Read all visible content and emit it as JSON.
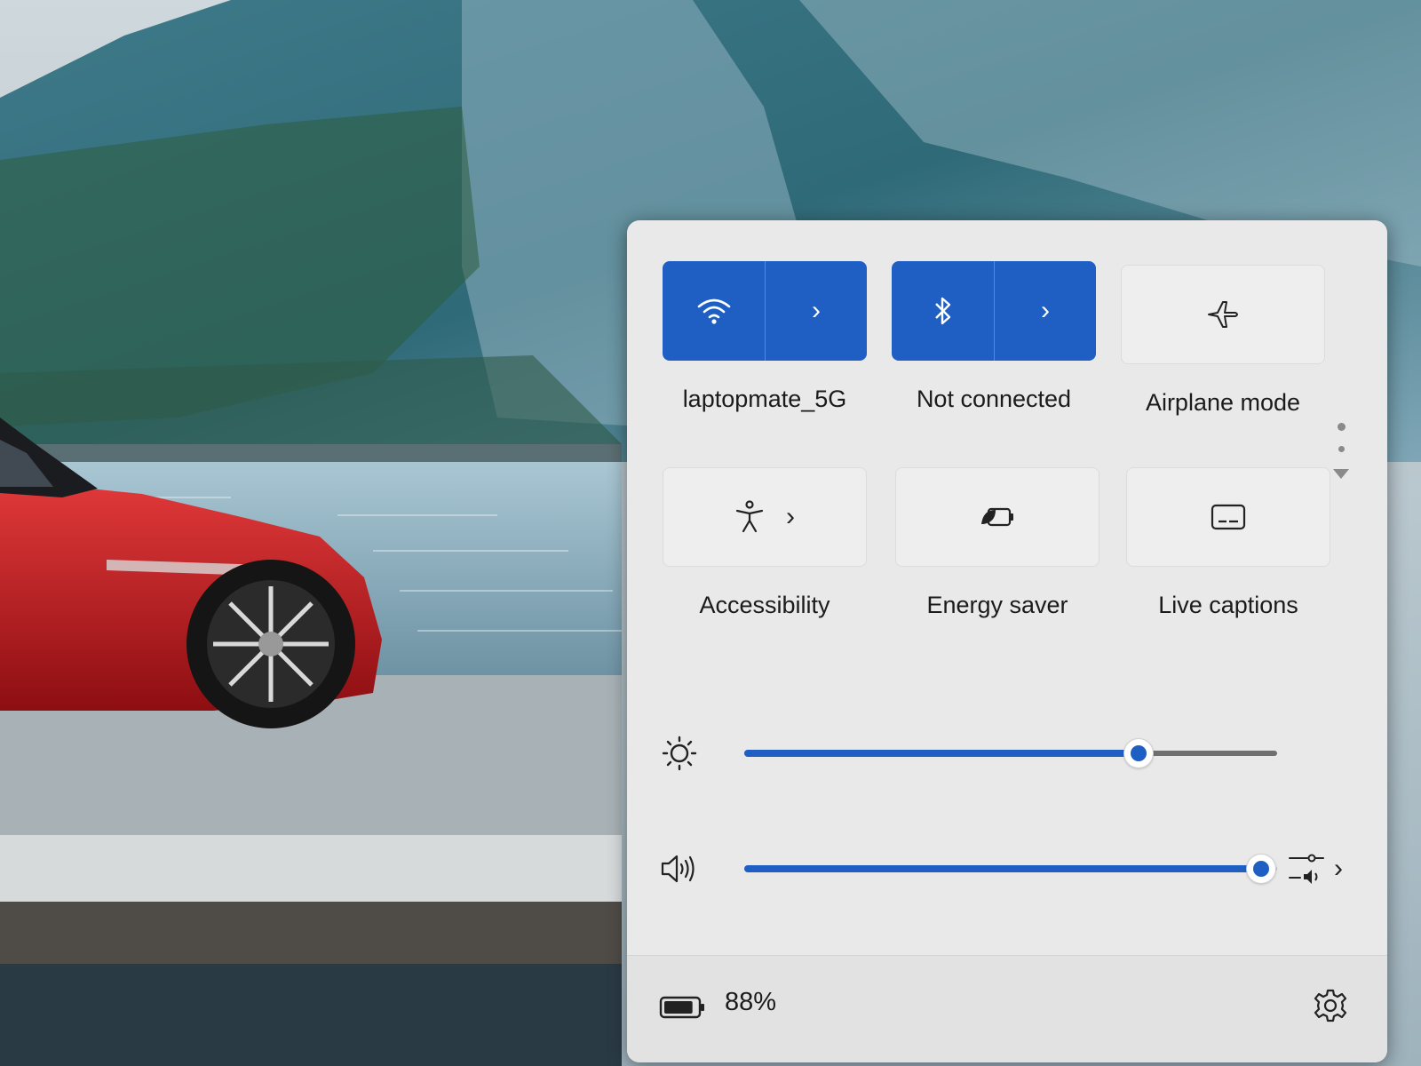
{
  "quick_settings": {
    "tiles": [
      {
        "label": "laptopmate_5G",
        "icon": "wifi-icon",
        "state": "on",
        "has_arrow": true
      },
      {
        "label": "Not connected",
        "icon": "bluetooth-icon",
        "state": "on",
        "has_arrow": true
      },
      {
        "label": "Airplane mode",
        "icon": "airplane-icon",
        "state": "off",
        "has_arrow": false
      },
      {
        "label": "Accessibility",
        "icon": "accessibility-icon",
        "state": "off",
        "has_arrow": true
      },
      {
        "label": "Energy saver",
        "icon": "energy-saver-icon",
        "state": "off",
        "has_arrow": false
      },
      {
        "label": "Live captions",
        "icon": "live-captions-icon",
        "state": "off",
        "has_arrow": false
      }
    ],
    "arrow_glyph": "›",
    "brightness": {
      "icon": "brightness-icon",
      "level": 0.74
    },
    "volume": {
      "icon": "speaker-icon",
      "level": 0.97,
      "audio_output_icon": "audio-output-icon"
    },
    "battery": {
      "icon": "battery-icon",
      "percent_text": "88%",
      "level": 0.88
    },
    "settings_icon": "gear-icon",
    "page_indicator": {
      "pages": 2,
      "current": 0
    }
  },
  "colors": {
    "accent": "#1f5fc4",
    "panel_bg": "#e9e9e9",
    "car_red": "#c8151b"
  }
}
